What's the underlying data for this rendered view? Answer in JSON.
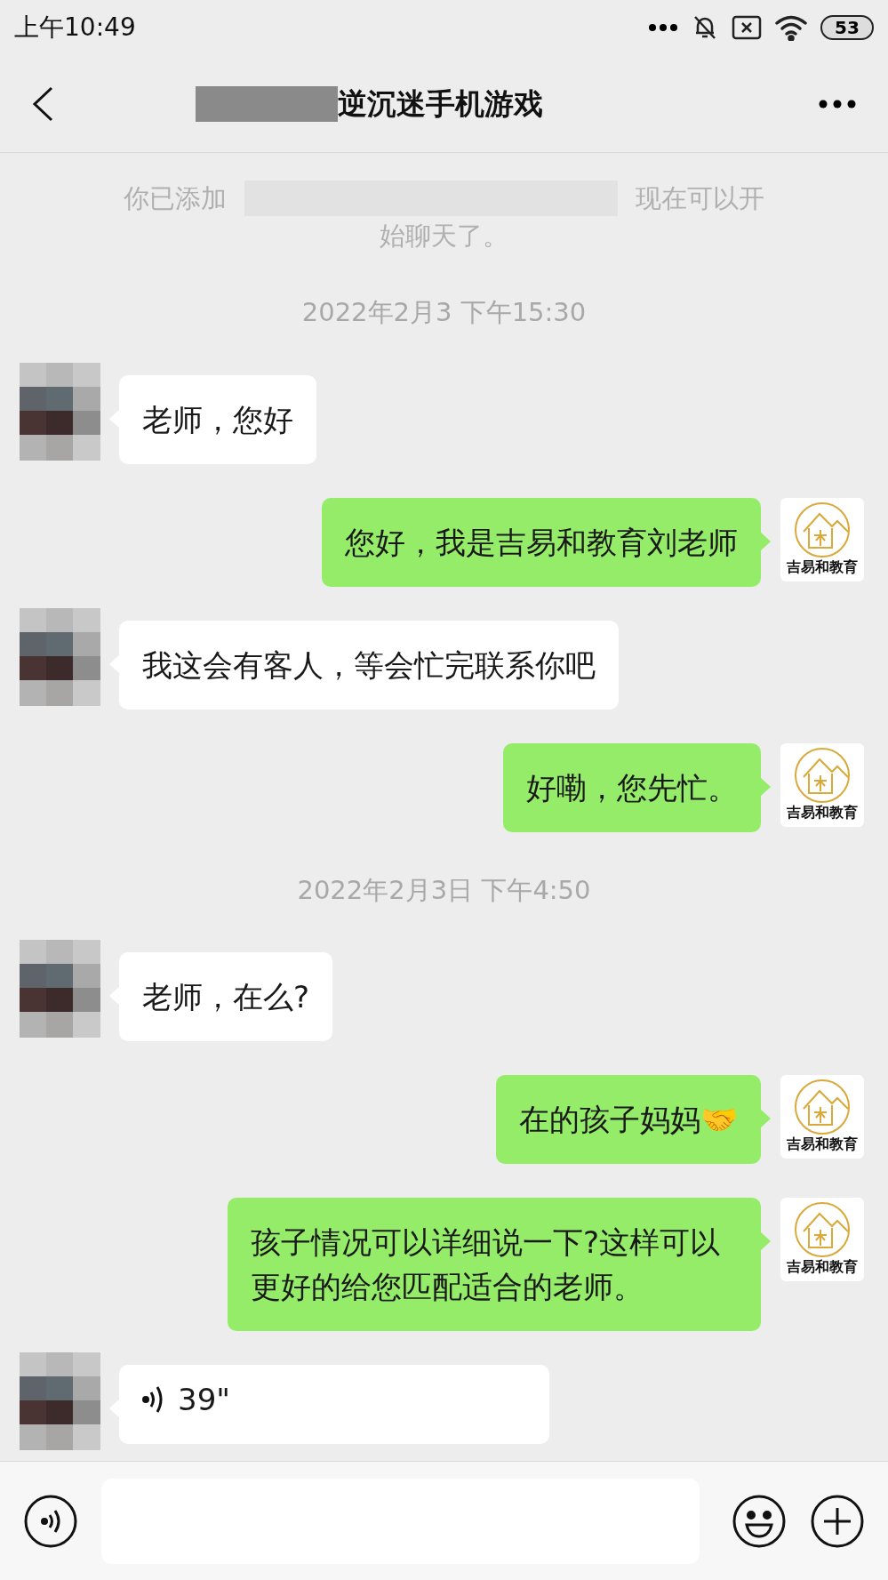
{
  "status_bar": {
    "time": "上午10:49",
    "battery": "53"
  },
  "header": {
    "title": "逆沉迷手机游戏"
  },
  "system_notice": {
    "before": "你已添加",
    "after": "现在可以开",
    "line2": "始聊天了。"
  },
  "messages": [
    {
      "kind": "time",
      "text": "2022年2月3 下午15:30"
    },
    {
      "kind": "incoming",
      "text": "老师，您好"
    },
    {
      "kind": "outgoing",
      "text": "您好，我是吉易和教育刘老师",
      "avatar_caption": "吉易和教育"
    },
    {
      "kind": "incoming",
      "text": "我这会有客人，等会忙完联系你吧"
    },
    {
      "kind": "outgoing",
      "text": "好嘞，您先忙。",
      "avatar_caption": "吉易和教育"
    },
    {
      "kind": "time",
      "text": "2022年2月3日 下午4:50"
    },
    {
      "kind": "incoming",
      "text": "老师，在么?"
    },
    {
      "kind": "outgoing",
      "text": "在的孩子妈妈🤝",
      "avatar_caption": "吉易和教育"
    },
    {
      "kind": "outgoing",
      "text": "孩子情况可以详细说一下?这样可以更好的给您匹配适合的老师。",
      "avatar_caption": "吉易和教育"
    },
    {
      "kind": "voice",
      "text": "39\""
    }
  ]
}
